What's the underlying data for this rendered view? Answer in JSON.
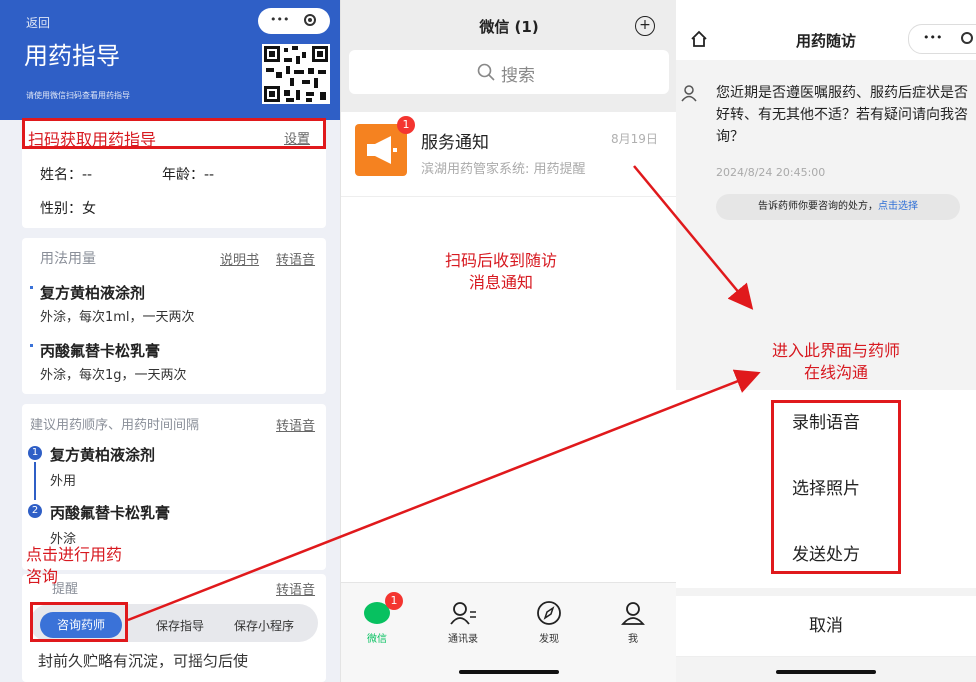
{
  "left": {
    "back": "返回",
    "title": "用药指导",
    "hint": "请使用微信扫码查看用药指导",
    "capsule_more": "•••",
    "scan_title": "扫码获取用药指导",
    "settings": "设置",
    "name": "姓名：--",
    "age": "年龄：--",
    "gender": "性别：女",
    "usage_title": "用法用量",
    "manual_link": "说明书",
    "tts_link": "转语音",
    "drug1_name": "复方黄柏液涂剂",
    "drug1_dose": "外涂，每次1ml，一天两次",
    "drug2_name": "丙酸氟替卡松乳膏",
    "drug2_dose": "外涂，每次1g，一天两次",
    "order_title": "建议用药顺序、用药时间间隔",
    "order_tts": "转语音",
    "step1_name": "复方黄柏液涂剂",
    "step1_sub": "外用",
    "step2_name": "丙酸氟替卡松乳膏",
    "step2_sub": "外涂",
    "remind_title": "提醒",
    "remind_tts": "转语音",
    "bottom_text": "封前久贮略有沉淀，可摇匀后使",
    "btn_consult": "咨询药师",
    "btn_save_guide": "保存指导",
    "btn_save_mini": "保存小程序",
    "annotation": "点击进行用药\n咨询"
  },
  "middle": {
    "title": "微信 (1)",
    "search": "搜索",
    "chat_name": "服务通知",
    "chat_date": "8月19日",
    "chat_preview": "滨湖用药管家系统: 用药提醒",
    "chat_badge": "1",
    "annotation": "扫码后收到随访\n消息通知",
    "tabs": [
      {
        "label": "微信",
        "badge": "1"
      },
      {
        "label": "通讯录"
      },
      {
        "label": "发现"
      },
      {
        "label": "我"
      }
    ]
  },
  "right": {
    "title": "用药随访",
    "capsule_more": "•••",
    "message": "您近期是否遵医嘱服药、服药后症状是否好转、有无其他不适？若有疑问请向我咨询？",
    "message_time": "2024/8/24 20:45:00",
    "prescription_tip": "告诉药师你要咨询的处方，",
    "prescription_link": "点击选择",
    "annotation": "进入此界面与药师\n在线沟通",
    "options": [
      "录制语音",
      "选择照片",
      "发送处方"
    ],
    "cancel": "取消"
  },
  "colors": {
    "brand_blue": "#2f5fc6",
    "annotation_red": "#d71920",
    "wechat_green": "#07c160",
    "badge_red": "#f43530"
  }
}
